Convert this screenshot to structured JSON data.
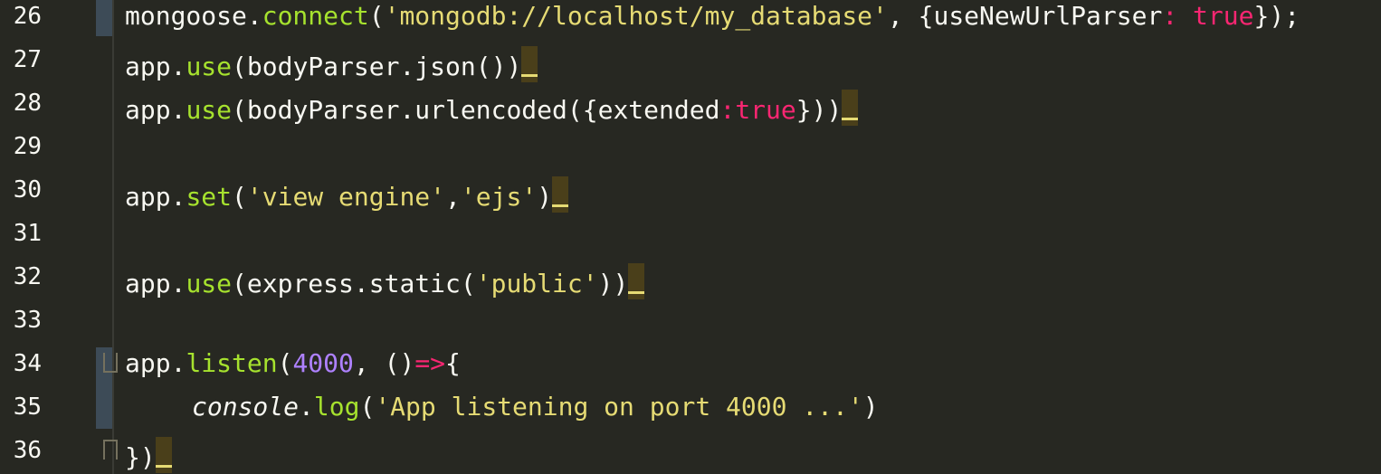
{
  "lines": [
    {
      "num": "26",
      "tokens": [
        {
          "t": "mongoose.",
          "c": "plain"
        },
        {
          "t": "connect",
          "c": "fn"
        },
        {
          "t": "(",
          "c": "plain"
        },
        {
          "t": "'mongodb://localhost/my_database'",
          "c": "str"
        },
        {
          "t": ", {useNewUrlParser",
          "c": "plain"
        },
        {
          "t": ": ",
          "c": "kw"
        },
        {
          "t": "true",
          "c": "kw"
        },
        {
          "t": "});",
          "c": "plain"
        }
      ]
    },
    {
      "num": "27",
      "tokens": [
        {
          "t": "app.",
          "c": "plain"
        },
        {
          "t": "use",
          "c": "fn"
        },
        {
          "t": "(bodyParser.json())",
          "c": "plain"
        }
      ]
    },
    {
      "num": "28",
      "tokens": [
        {
          "t": "app.",
          "c": "plain"
        },
        {
          "t": "use",
          "c": "fn"
        },
        {
          "t": "(bodyParser.urlencoded({extended",
          "c": "plain"
        },
        {
          "t": ":",
          "c": "kw"
        },
        {
          "t": "true",
          "c": "kw"
        },
        {
          "t": "}))",
          "c": "plain"
        }
      ]
    },
    {
      "num": "29",
      "tokens": []
    },
    {
      "num": "30",
      "tokens": [
        {
          "t": "app.",
          "c": "plain"
        },
        {
          "t": "set",
          "c": "fn"
        },
        {
          "t": "(",
          "c": "plain"
        },
        {
          "t": "'view engine'",
          "c": "str"
        },
        {
          "t": ",",
          "c": "plain"
        },
        {
          "t": "'ejs'",
          "c": "str"
        },
        {
          "t": ")",
          "c": "plain"
        }
      ]
    },
    {
      "num": "31",
      "tokens": []
    },
    {
      "num": "32",
      "tokens": [
        {
          "t": "app.",
          "c": "plain"
        },
        {
          "t": "use",
          "c": "fn"
        },
        {
          "t": "(express.static(",
          "c": "plain"
        },
        {
          "t": "'public'",
          "c": "str"
        },
        {
          "t": "))",
          "c": "plain"
        }
      ]
    },
    {
      "num": "33",
      "tokens": []
    },
    {
      "num": "34",
      "tokens": [
        {
          "t": "app.",
          "c": "plain"
        },
        {
          "t": "listen",
          "c": "fn"
        },
        {
          "t": "(",
          "c": "plain"
        },
        {
          "t": "4000",
          "c": "num"
        },
        {
          "t": ", ()",
          "c": "plain"
        },
        {
          "t": "=>",
          "c": "kw"
        },
        {
          "t": "{",
          "c": "plain"
        }
      ]
    },
    {
      "num": "35",
      "tokens": [
        {
          "t": "console",
          "c": "italic"
        },
        {
          "t": ".",
          "c": "plain"
        },
        {
          "t": "log",
          "c": "fn"
        },
        {
          "t": "(",
          "c": "plain"
        },
        {
          "t": "'App listening on port 4000 ...'",
          "c": "str"
        },
        {
          "t": ")",
          "c": "plain"
        }
      ]
    },
    {
      "num": "36",
      "tokens": [
        {
          "t": "})",
          "c": "plain"
        }
      ]
    }
  ],
  "colors": {
    "background": "#272822",
    "foreground": "#F8F8F2",
    "function": "#A6E22E",
    "string": "#E6DB74",
    "keyword": "#F92672",
    "number": "#AE81FF",
    "diff_bar": "#3D4B57"
  },
  "icons": {
    "fold_open": "fold-open-icon",
    "fold_close": "fold-close-icon"
  }
}
